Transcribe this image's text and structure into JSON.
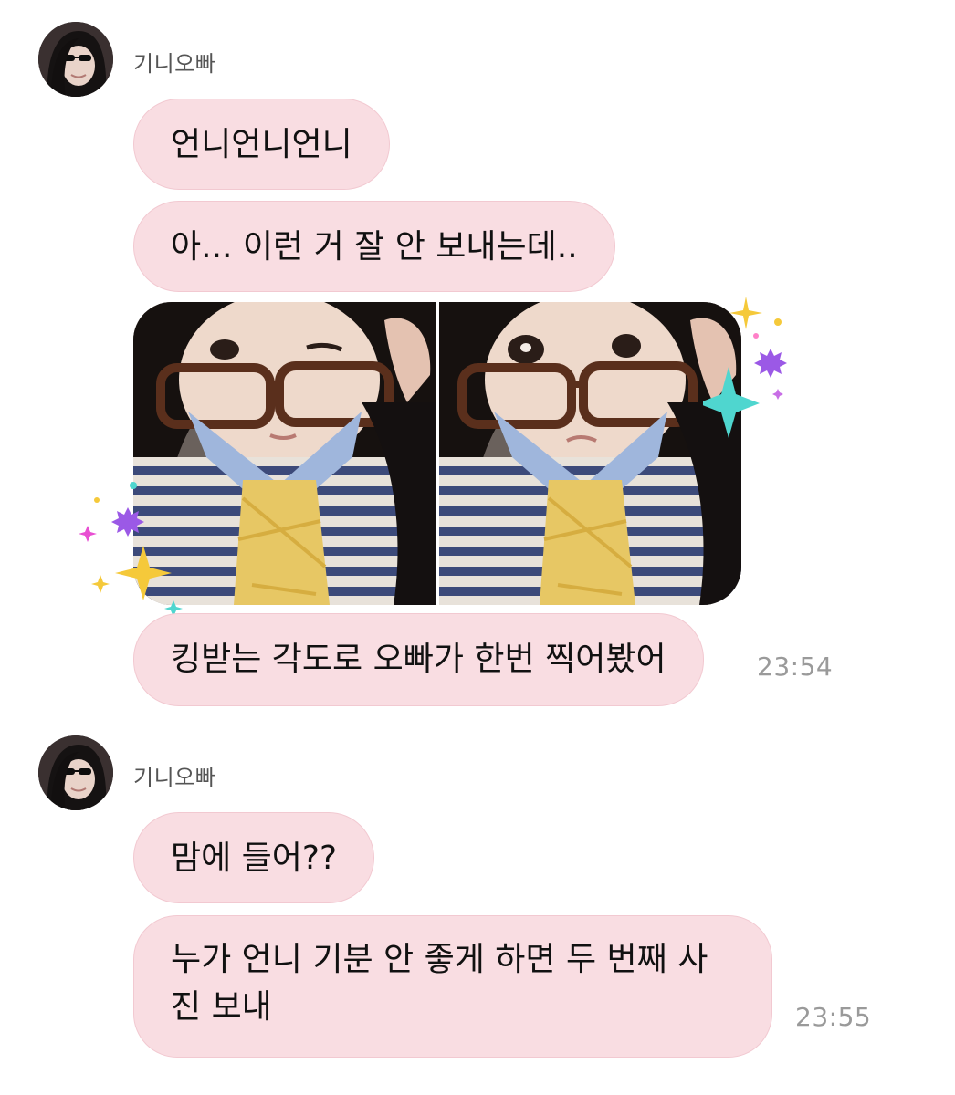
{
  "messages": [
    {
      "sender": "기니오빠",
      "bubbles": [
        "언니언니언니",
        "아... 이런 거 잘 안 보내는데..",
        "킹받는 각도로 오빠가 한번 찍어봤어"
      ],
      "photos": [
        "selfie-wink",
        "selfie-pout"
      ],
      "time": "23:54"
    },
    {
      "sender": "기니오빠",
      "bubbles": [
        "맘에 들어??",
        "누가 언니 기분 안 좋게 하면 두 번째 사진 보내"
      ],
      "time": "23:55"
    }
  ],
  "colors": {
    "bubble_bg": "#f9dde2",
    "bubble_border": "#f2c9d1",
    "time_text": "#9a9a9a",
    "sender_text": "#555555",
    "sparkle_yellow": "#f5c93a",
    "sparkle_purple": "#9b59e6",
    "sparkle_teal": "#4fd6cf"
  }
}
